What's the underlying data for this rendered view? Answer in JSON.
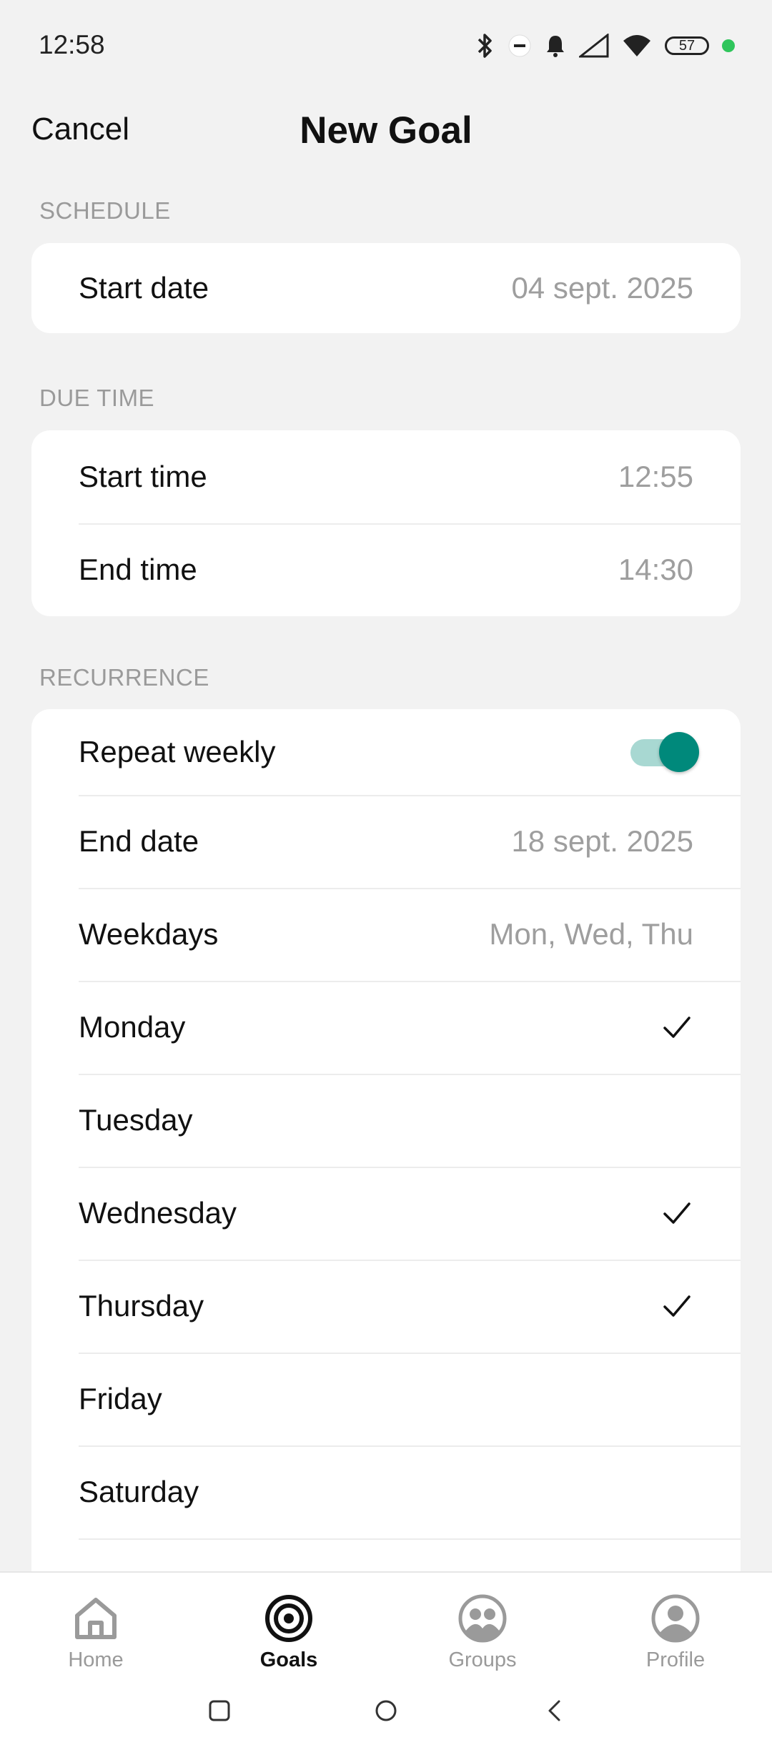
{
  "status_bar": {
    "time": "12:58",
    "battery": "57",
    "icons": [
      "bluetooth-icon",
      "dnd-icon",
      "bell-icon",
      "signal-icon",
      "wifi-icon",
      "battery-icon"
    ]
  },
  "header": {
    "cancel": "Cancel",
    "title": "New Goal"
  },
  "schedule": {
    "label": "SCHEDULE",
    "start_date_label": "Start date",
    "start_date_value": "04 sept. 2025"
  },
  "due_time": {
    "label": "DUE TIME",
    "start_time_label": "Start time",
    "start_time_value": "12:55",
    "end_time_label": "End time",
    "end_time_value": "14:30"
  },
  "recurrence": {
    "label": "RECURRENCE",
    "repeat_weekly_label": "Repeat weekly",
    "repeat_weekly_on": true,
    "end_date_label": "End date",
    "end_date_value": "18 sept. 2025",
    "weekdays_label": "Weekdays",
    "weekdays_value": "Mon, Wed, Thu",
    "days": [
      {
        "name": "Monday",
        "checked": true
      },
      {
        "name": "Tuesday",
        "checked": false
      },
      {
        "name": "Wednesday",
        "checked": true
      },
      {
        "name": "Thursday",
        "checked": true
      },
      {
        "name": "Friday",
        "checked": false
      },
      {
        "name": "Saturday",
        "checked": false
      }
    ]
  },
  "bottom_nav": {
    "tabs": [
      {
        "label": "Home",
        "icon": "home-icon",
        "active": false
      },
      {
        "label": "Goals",
        "icon": "target-icon",
        "active": true
      },
      {
        "label": "Groups",
        "icon": "groups-icon",
        "active": false
      },
      {
        "label": "Profile",
        "icon": "profile-icon",
        "active": false
      }
    ]
  },
  "colors": {
    "accent": "#00897b",
    "accent_track": "#a8d8d2",
    "background": "#f2f2f2",
    "muted_text": "#9e9e9e"
  }
}
